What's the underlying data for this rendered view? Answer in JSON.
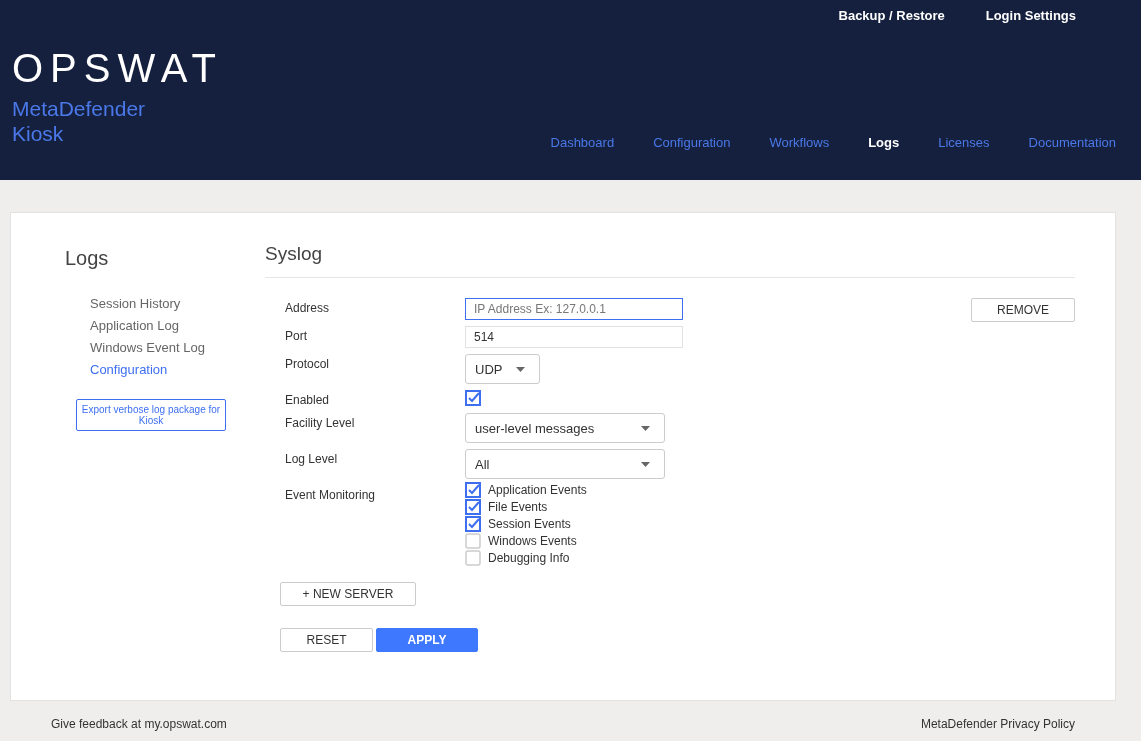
{
  "header": {
    "top_links": [
      "Backup / Restore",
      "Login Settings"
    ],
    "logo": "OPSWAT",
    "product": [
      "MetaDefender",
      "Kiosk"
    ],
    "nav": [
      {
        "label": "Dashboard",
        "selected": false
      },
      {
        "label": "Configuration",
        "selected": false
      },
      {
        "label": "Workflows",
        "selected": false
      },
      {
        "label": "Logs",
        "selected": true
      },
      {
        "label": "Licenses",
        "selected": false
      },
      {
        "label": "Documentation",
        "selected": false
      }
    ]
  },
  "sidebar": {
    "title": "Logs",
    "items": [
      {
        "label": "Session History",
        "selected": false
      },
      {
        "label": "Application Log",
        "selected": false
      },
      {
        "label": "Windows Event Log",
        "selected": false
      },
      {
        "label": "Configuration",
        "selected": true
      }
    ],
    "export_button": "Export verbose log package for Kiosk"
  },
  "syslog": {
    "title": "Syslog",
    "remove_button": "REMOVE",
    "fields": [
      {
        "kind": "text",
        "label": "Address",
        "placeholder": "IP Address Ex: 127.0.0.1",
        "focused": true
      },
      {
        "kind": "text",
        "label": "Port",
        "value": "514",
        "focused": false
      },
      {
        "kind": "short-select",
        "label": "Protocol",
        "value": "UDP"
      },
      {
        "kind": "checkbox",
        "label": "Enabled",
        "checked": true
      },
      {
        "kind": "select",
        "label": "Facility Level",
        "value": "user-level messages"
      },
      {
        "kind": "select",
        "label": "Log Level",
        "value": "All"
      },
      {
        "kind": "checklist",
        "label": "Event Monitoring",
        "options": [
          {
            "label": "Application Events",
            "checked": true
          },
          {
            "label": "File Events",
            "checked": true
          },
          {
            "label": "Session Events",
            "checked": true
          },
          {
            "label": "Windows Events",
            "checked": false
          },
          {
            "label": "Debugging Info",
            "checked": false
          }
        ]
      }
    ],
    "new_server_button": "+ NEW SERVER",
    "reset_button": "RESET",
    "apply_button": "APPLY"
  },
  "footer": {
    "feedback": "Give feedback at my.opswat.com",
    "privacy": "MetaDefender Privacy Policy"
  }
}
